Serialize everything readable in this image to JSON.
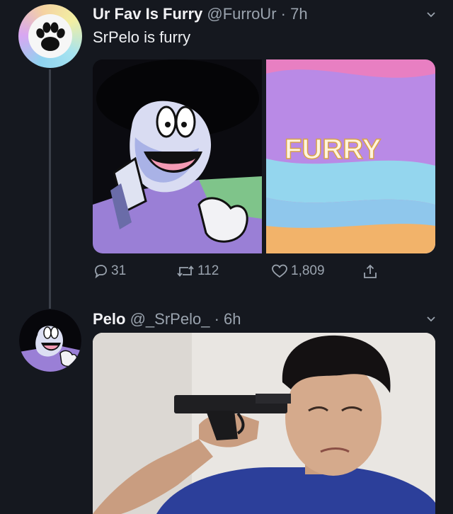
{
  "tweets": [
    {
      "display_name": "Ur Fav Is Furry",
      "handle": "@FurroUr",
      "separator": "·",
      "time": "7h",
      "text": "SrPelo is furry",
      "media": {
        "right_text": "FURRY"
      },
      "actions": {
        "replies": "31",
        "retweets": "112",
        "likes": "1,809"
      }
    },
    {
      "display_name": "Pelo",
      "handle": "@_SrPelo_",
      "separator": "·",
      "time": "6h"
    }
  ],
  "icons": {
    "reply": "reply-icon",
    "retweet": "retweet-icon",
    "like": "like-icon",
    "share": "share-icon",
    "caret": "chevron-down-icon",
    "paw": "paw-icon"
  },
  "colors": {
    "background": "#15181f",
    "text_secondary": "#9aa3ae",
    "thread_line": "#3a3f49"
  }
}
